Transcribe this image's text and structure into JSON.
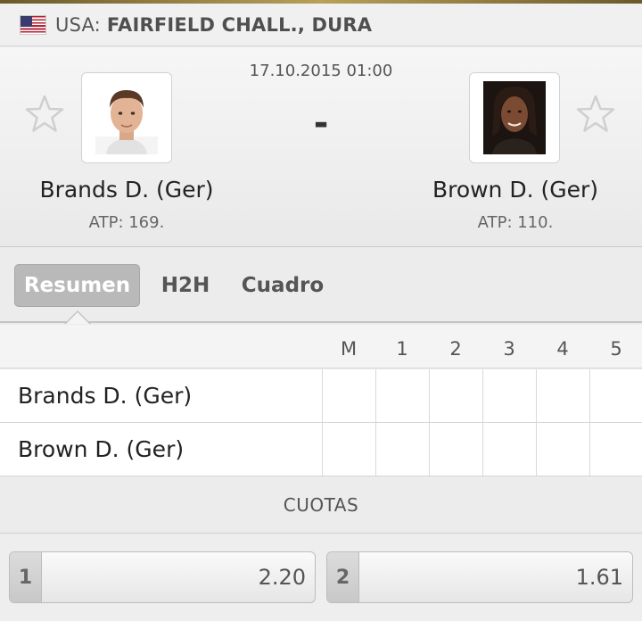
{
  "tournament": {
    "country": "USA:",
    "name": "FAIRFIELD CHALL., DURA",
    "flag_icon": "usa-flag-icon"
  },
  "match": {
    "datetime": "17.10.2015 01:00",
    "score": "-",
    "home": {
      "name": "Brands D. (Ger)",
      "rank": "ATP: 169."
    },
    "away": {
      "name": "Brown D. (Ger)",
      "rank": "ATP: 110."
    }
  },
  "tabs": [
    {
      "label": "Resumen",
      "active": true
    },
    {
      "label": "H2H",
      "active": false
    },
    {
      "label": "Cuadro",
      "active": false
    }
  ],
  "score_table": {
    "columns": [
      "M",
      "1",
      "2",
      "3",
      "4",
      "5"
    ],
    "rows": [
      {
        "player": "Brands D. (Ger)",
        "values": [
          "",
          "",
          "",
          "",
          "",
          ""
        ]
      },
      {
        "player": "Brown D. (Ger)",
        "values": [
          "",
          "",
          "",
          "",
          "",
          ""
        ]
      }
    ]
  },
  "odds": {
    "header": "CUOTAS",
    "items": [
      {
        "label": "1",
        "value": "2.20"
      },
      {
        "label": "2",
        "value": "1.61"
      }
    ]
  },
  "colors": {
    "active_tab_bg": "#b9b9b9",
    "star_outline": "#d0d0d0",
    "accent_gold": "#b8a05a"
  }
}
